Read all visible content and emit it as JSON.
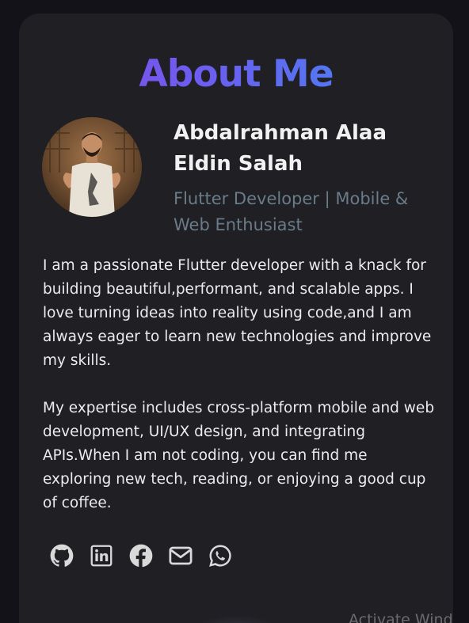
{
  "about": {
    "title": "About Me",
    "name": "Abdalrahman Alaa Eldin Salah",
    "role": "Flutter Developer | Mobile & Web Enthusiast",
    "bio": [
      "I am a passionate Flutter developer with a knack for building beautiful,performant, and scalable apps. I love turning ideas into reality using code,and I am always eager to learn new technologies and improve my skills.",
      "My expertise includes cross-platform mobile and web development, UI/UX design, and integrating APIs.When I am not coding, you can find me exploring new tech, reading, or enjoying a good cup of coffee."
    ],
    "title_gradient": [
      "#8a49ea",
      "#3d8ef2"
    ],
    "role_color": "#6a7c89"
  },
  "socials": [
    {
      "icon": "github-icon"
    },
    {
      "icon": "linkedin-icon"
    },
    {
      "icon": "facebook-icon"
    },
    {
      "icon": "envelope-icon"
    },
    {
      "icon": "whatsapp-icon"
    }
  ],
  "overlay": {
    "watermark": "Activate Wind"
  }
}
